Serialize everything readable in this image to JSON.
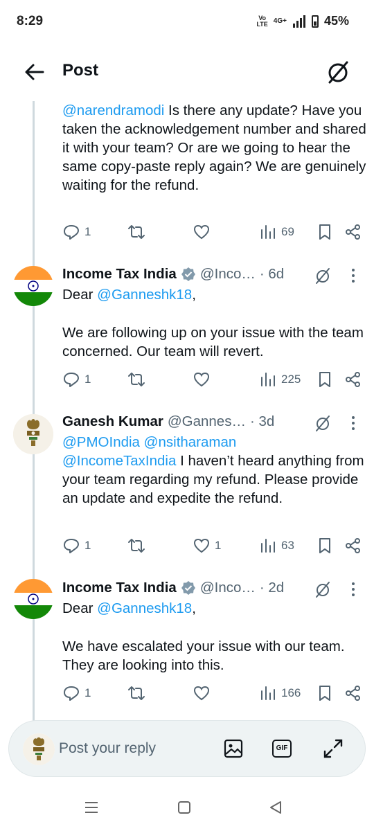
{
  "status_bar": {
    "time": "8:29",
    "network": "4G+",
    "volte_top": "Vo",
    "volte_bottom": "LTE",
    "battery": "45%"
  },
  "header": {
    "title": "Post"
  },
  "tweets": [
    {
      "body_prefix_link": "@narendramodi",
      "body": " Is there any update? Have you taken the acknowledgement number and shared it with your team? Or are we going to hear the same copy-paste reply again? We are genuinely waiting for the refund.",
      "replies": "1",
      "likes": "",
      "views": "69"
    },
    {
      "name": "Income Tax India",
      "handle": "@Inco…",
      "time": "· 6d",
      "greeting": "Dear ",
      "mention": "@Ganneshk18",
      "greeting_end": ",",
      "body": "We are following up on your issue with the team concerned. Our team will revert.",
      "replies": "1",
      "likes": "",
      "views": "225"
    },
    {
      "name": "Ganesh Kumar",
      "handle": "@Gannes…",
      "time": "· 3d",
      "mention1": "@PMOIndia",
      "mention2": "@nsitharaman",
      "mention3": "@IncomeTaxIndia",
      "body": " I haven’t heard anything from your team regarding my refund. Please provide an update and expedite the refund.",
      "replies": "1",
      "likes": "1",
      "views": "63"
    },
    {
      "name": "Income Tax India",
      "handle": "@Inco…",
      "time": "· 2d",
      "greeting": "Dear ",
      "mention": "@Ganneshk18",
      "greeting_end": ",",
      "body": "We have escalated your issue with our team. They are looking into this.",
      "replies": "1",
      "likes": "",
      "views": "166"
    }
  ],
  "reply_bar": {
    "placeholder": "Post your reply",
    "gif_label": "GIF"
  },
  "colors": {
    "link": "#1d9bf0",
    "muted": "#536471",
    "saffron": "#ff9933",
    "green": "#138808"
  }
}
